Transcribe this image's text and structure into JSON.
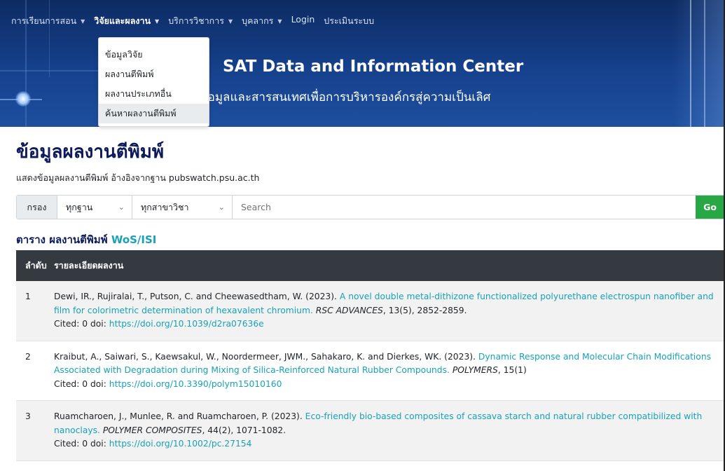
{
  "nav": {
    "items": [
      {
        "label": "การเรียนการสอน",
        "caret": "▼",
        "active": false
      },
      {
        "label": "วิจัยและผลงาน",
        "caret": "▼",
        "active": true
      },
      {
        "label": "บริการวิชาการ",
        "caret": "▼",
        "active": false
      },
      {
        "label": "บุคลากร",
        "caret": "▼",
        "active": false
      },
      {
        "label": "Login",
        "caret": "",
        "active": false
      },
      {
        "label": "ประเมินระบบ",
        "caret": "",
        "active": false
      }
    ]
  },
  "header": {
    "title": "SAT Data and Information Center",
    "subtitle": "ข้อมูลและสารสนเทศเพื่อการบริหารองค์กรสู่ความเป็นเลิศ"
  },
  "dropdown": {
    "items": [
      "ข้อมูลวิจัย",
      "ผลงานตีพิมพ์",
      "ผลงานประเภทอื่น",
      "ค้นหาผลงานตีพิมพ์"
    ],
    "hovered_index": 3
  },
  "page": {
    "title": "ข้อมูลผลงานตีพิมพ์",
    "description": "แสดงข้อมูลผลงานตีพิมพ์ อ้างอิงจากฐาน pubswatch.psu.ac.th"
  },
  "filter": {
    "label": "กรอง",
    "database_selected": "ทุกฐาน",
    "subject_selected": "ทุกสาขาวิชา",
    "search_placeholder": "Search",
    "go_label": "Go"
  },
  "table": {
    "title_prefix": "ตาราง ผลงานตีพิมพ์",
    "title_accent": "WoS/ISI",
    "columns": [
      "ลำดับ",
      "รายละเอียดผลงาน"
    ],
    "rows": [
      {
        "no": "1",
        "authors": "Dewi, IR., Rujiralai, T., Putson, C. and Cheewasedtham, W. (2023).",
        "title": "A novel double metal-dithizone functionalized polyurethane electrospun nanofiber and film for colorimetric determination of hexavalent chromium.",
        "journal": "RSC ADVANCES",
        "details": ", 13(5), 2852-2859.",
        "cited": "Cited: 0 doi:",
        "doi": "https://doi.org/10.1039/d2ra07636e"
      },
      {
        "no": "2",
        "authors": "Kraibut, A., Saiwari, S., Kaewsakul, W., Noordermeer, JWM., Sahakaro, K. and Dierkes, WK. (2023).",
        "title": "Dynamic Response and Molecular Chain Modifications Associated with Degradation during Mixing of Silica-Reinforced Natural Rubber Compounds.",
        "journal": "POLYMERS",
        "details": ", 15(1)",
        "cited": "Cited: 0 doi:",
        "doi": "https://doi.org/10.3390/polym15010160"
      },
      {
        "no": "3",
        "authors": "Ruamcharoen, J., Munlee, R. and Ruamcharoen, P. (2023).",
        "title": "Eco-friendly bio-based composites of cassava starch and natural rubber compatibilized with nanoclays.",
        "journal": "POLYMER COMPOSITES",
        "details": ", 44(2), 1071-1082.",
        "cited": "Cited: 0 doi:",
        "doi": "https://doi.org/10.1002/pc.27154"
      }
    ]
  },
  "colors": {
    "banner": "#16418d",
    "title": "#0d1b5c",
    "link": "#17a2b8",
    "go": "#28a745",
    "thead": "#343a40"
  }
}
